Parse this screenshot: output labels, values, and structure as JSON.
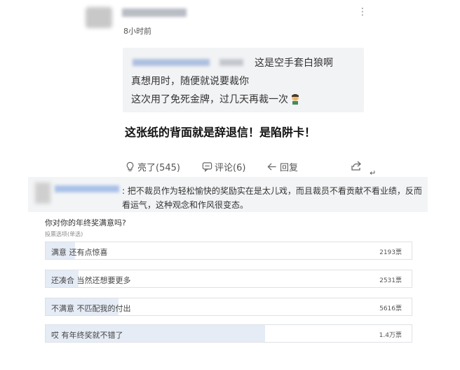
{
  "post": {
    "time": "8小时前",
    "more_icon": "more-vertical-icon"
  },
  "quote": {
    "line1_suffix": "这是空手套白狼啊",
    "line2": "真想用时，随便就说要裁你",
    "line3": "这次用了免死金牌，过几天再裁一次"
  },
  "headline": "这张纸的背面就是辞退信！是陷阱卡！",
  "actions": {
    "like_label": "亮了(545)",
    "comment_label": "评论(6)",
    "reply_label": "回复"
  },
  "comment2": {
    "text": ": 把不裁员作为轻松愉快的奖励实在是太儿戏，而且裁员不看贡献不看业绩，反而看运气，这种观念和作风很变态。"
  },
  "poll": {
    "question": "你对你的年终奖满意吗?",
    "subtitle": "投票选项(单选)",
    "options": [
      {
        "label": "满意 还有点惊喜",
        "count": "2193票",
        "share": 0.08
      },
      {
        "label": "还凑合 当然还想要更多",
        "count": "2531票",
        "share": 0.09
      },
      {
        "label": "不满意 不匹配我的付出",
        "count": "5616票",
        "share": 0.2
      },
      {
        "label": "哎 有年终奖就不错了",
        "count": "1.4万票",
        "share": 0.6
      }
    ]
  },
  "colors": {
    "poll_fill": "#e6ecf6",
    "quote_bg": "#f2f3f5"
  }
}
